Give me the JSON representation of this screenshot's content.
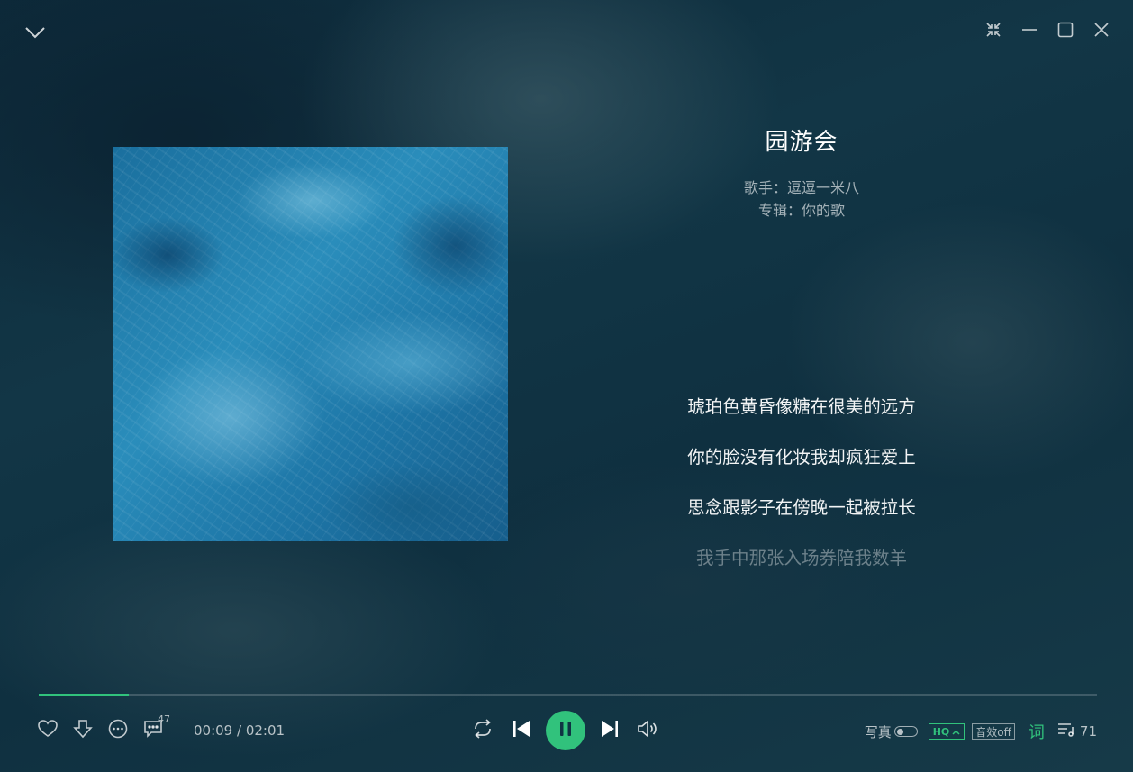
{
  "window": {
    "collapse_icon": "chevron-down-icon",
    "controls": [
      "mini-mode-icon",
      "minimize-icon",
      "maximize-icon",
      "close-icon"
    ]
  },
  "song": {
    "title": "园游会",
    "artist_line": "歌手：逗逗一米八",
    "album_line": "专辑：你的歌"
  },
  "lyrics": [
    "琥珀色黄昏像糖在很美的远方",
    "你的脸没有化妆我却疯狂爱上",
    "思念跟影子在傍晚一起被拉长",
    "我手中那张入场券陪我数羊"
  ],
  "progress": {
    "current": "00:09",
    "total": "02:01",
    "display": "00:09 / 02:01",
    "fraction": 0.085
  },
  "actions": {
    "comment_count": "47"
  },
  "right_controls": {
    "photo_label": "写真",
    "quality": "HQ",
    "effect": "音效off",
    "lyric_label": "词",
    "playlist_count": "71"
  },
  "colors": {
    "accent": "#31c27c",
    "background": "#123646"
  }
}
